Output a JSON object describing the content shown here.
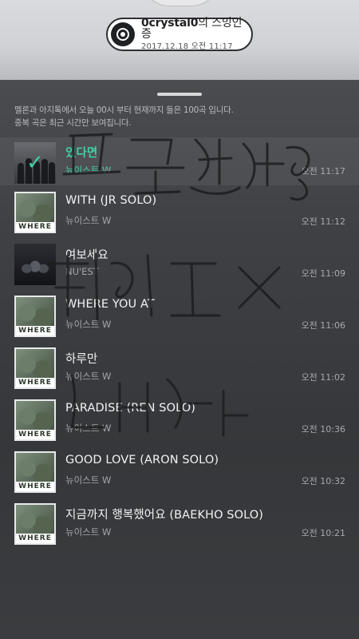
{
  "certificate": {
    "user": "0crystal0",
    "suffix": "의 스밍인증",
    "datetime": "2017.12.18 오전 11:17",
    "icon": "disc-icon"
  },
  "notice": {
    "line1": "멜론과 아지톡에서 오늘 00시 부터 현재까지 들은 100곡 입니다.",
    "line2": "중복 곡은 최근 시간만 보여집니다."
  },
  "songs": [
    {
      "title": "있다면",
      "artist": "뉴이스트 W",
      "time": "오전 11:17",
      "now_playing": true
    },
    {
      "title": "WITH (JR SOLO)",
      "artist": "뉴이스트 W",
      "time": "오전 11:12"
    },
    {
      "title": "여보세요",
      "artist": "NU'EST",
      "time": "오전 11:09"
    },
    {
      "title": "WHERE YOU AT",
      "artist": "뉴이스트 W",
      "time": "오전 11:06"
    },
    {
      "title": "하루만",
      "artist": "뉴이스트 W",
      "time": "오전 11:02"
    },
    {
      "title": "PARADISE (REN SOLO)",
      "artist": "뉴이스트 W",
      "time": "오전 10:36"
    },
    {
      "title": "GOOD LOVE (ARON SOLO)",
      "artist": "뉴이스트 W",
      "time": "오전 10:32"
    },
    {
      "title": "지금까지 행복했어요 (BAEKHO SOLO)",
      "artist": "뉴이스트 W",
      "time": "오전 10:21"
    }
  ],
  "album_label": "WHERE",
  "colors": {
    "accent": "#3fd0a6",
    "background": "#3e4044",
    "scribble": "#1c1d1f"
  }
}
